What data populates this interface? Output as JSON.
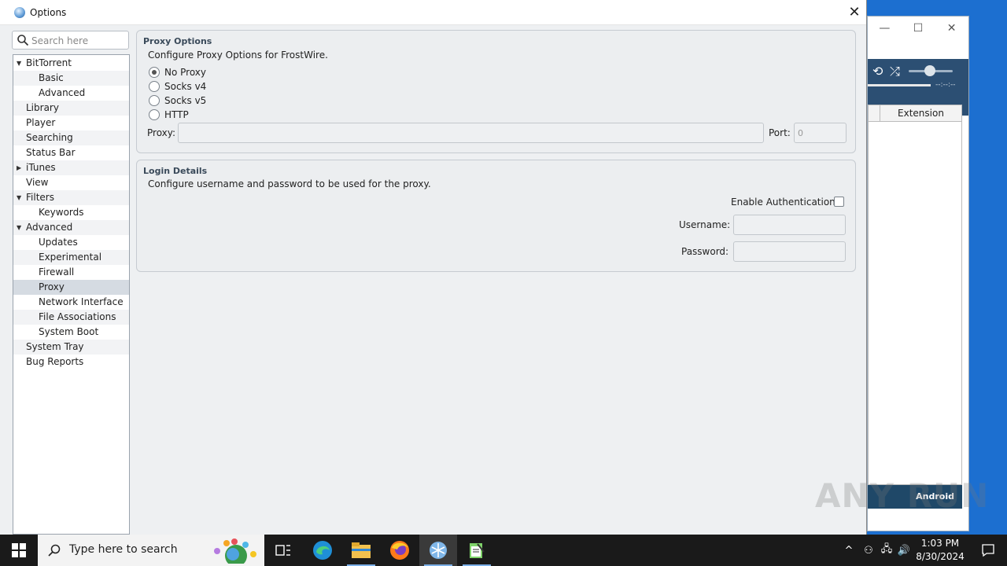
{
  "dialog": {
    "title": "Options",
    "search_placeholder": "Search here"
  },
  "tree": [
    {
      "label": "BitTorrent",
      "level": 0,
      "toggle": "expanded",
      "top": 1
    },
    {
      "label": "Basic",
      "level": 1
    },
    {
      "label": "Advanced",
      "level": 1
    },
    {
      "label": "Library",
      "level": 0
    },
    {
      "label": "Player",
      "level": 0
    },
    {
      "label": "Searching",
      "level": 0
    },
    {
      "label": "Status Bar",
      "level": 0
    },
    {
      "label": "iTunes",
      "level": 0,
      "toggle": "collapsed"
    },
    {
      "label": "View",
      "level": 0
    },
    {
      "label": "Filters",
      "level": 0,
      "toggle": "expanded"
    },
    {
      "label": "Keywords",
      "level": 1
    },
    {
      "label": "Advanced",
      "level": 0,
      "toggle": "expanded"
    },
    {
      "label": "Updates",
      "level": 1
    },
    {
      "label": "Experimental",
      "level": 1
    },
    {
      "label": "Firewall",
      "level": 1
    },
    {
      "label": "Proxy",
      "level": 1,
      "selected": true
    },
    {
      "label": "Network Interface",
      "level": 1
    },
    {
      "label": "File Associations",
      "level": 1
    },
    {
      "label": "System Boot",
      "level": 1
    },
    {
      "label": "System Tray",
      "level": 0
    },
    {
      "label": "Bug Reports",
      "level": 0
    }
  ],
  "proxy_options": {
    "title": "Proxy Options",
    "description": "Configure Proxy Options for FrostWire.",
    "radios": [
      {
        "label": "No Proxy",
        "checked": true
      },
      {
        "label": "Socks v4",
        "checked": false
      },
      {
        "label": "Socks v5",
        "checked": false
      },
      {
        "label": "HTTP",
        "checked": false
      }
    ],
    "proxy_label": "Proxy:",
    "proxy_value": "",
    "port_label": "Port:",
    "port_value": "0"
  },
  "login_details": {
    "title": "Login Details",
    "description": "Configure username and password to be used for the proxy.",
    "enable_auth_label": "Enable Authentication:",
    "enable_auth_checked": false,
    "username_label": "Username:",
    "username_value": "",
    "password_label": "Password:",
    "password_value": ""
  },
  "background_window": {
    "column_header": "Extension",
    "time": "--:--:--",
    "promo_text": "Android"
  },
  "taskbar": {
    "search_placeholder": "Type here to search",
    "time": "1:03 PM",
    "date": "8/30/2024",
    "apps": [
      "task-view",
      "edge",
      "file-explorer",
      "firefox",
      "frostwire",
      "notepad"
    ]
  },
  "watermark": "ANY RUN"
}
